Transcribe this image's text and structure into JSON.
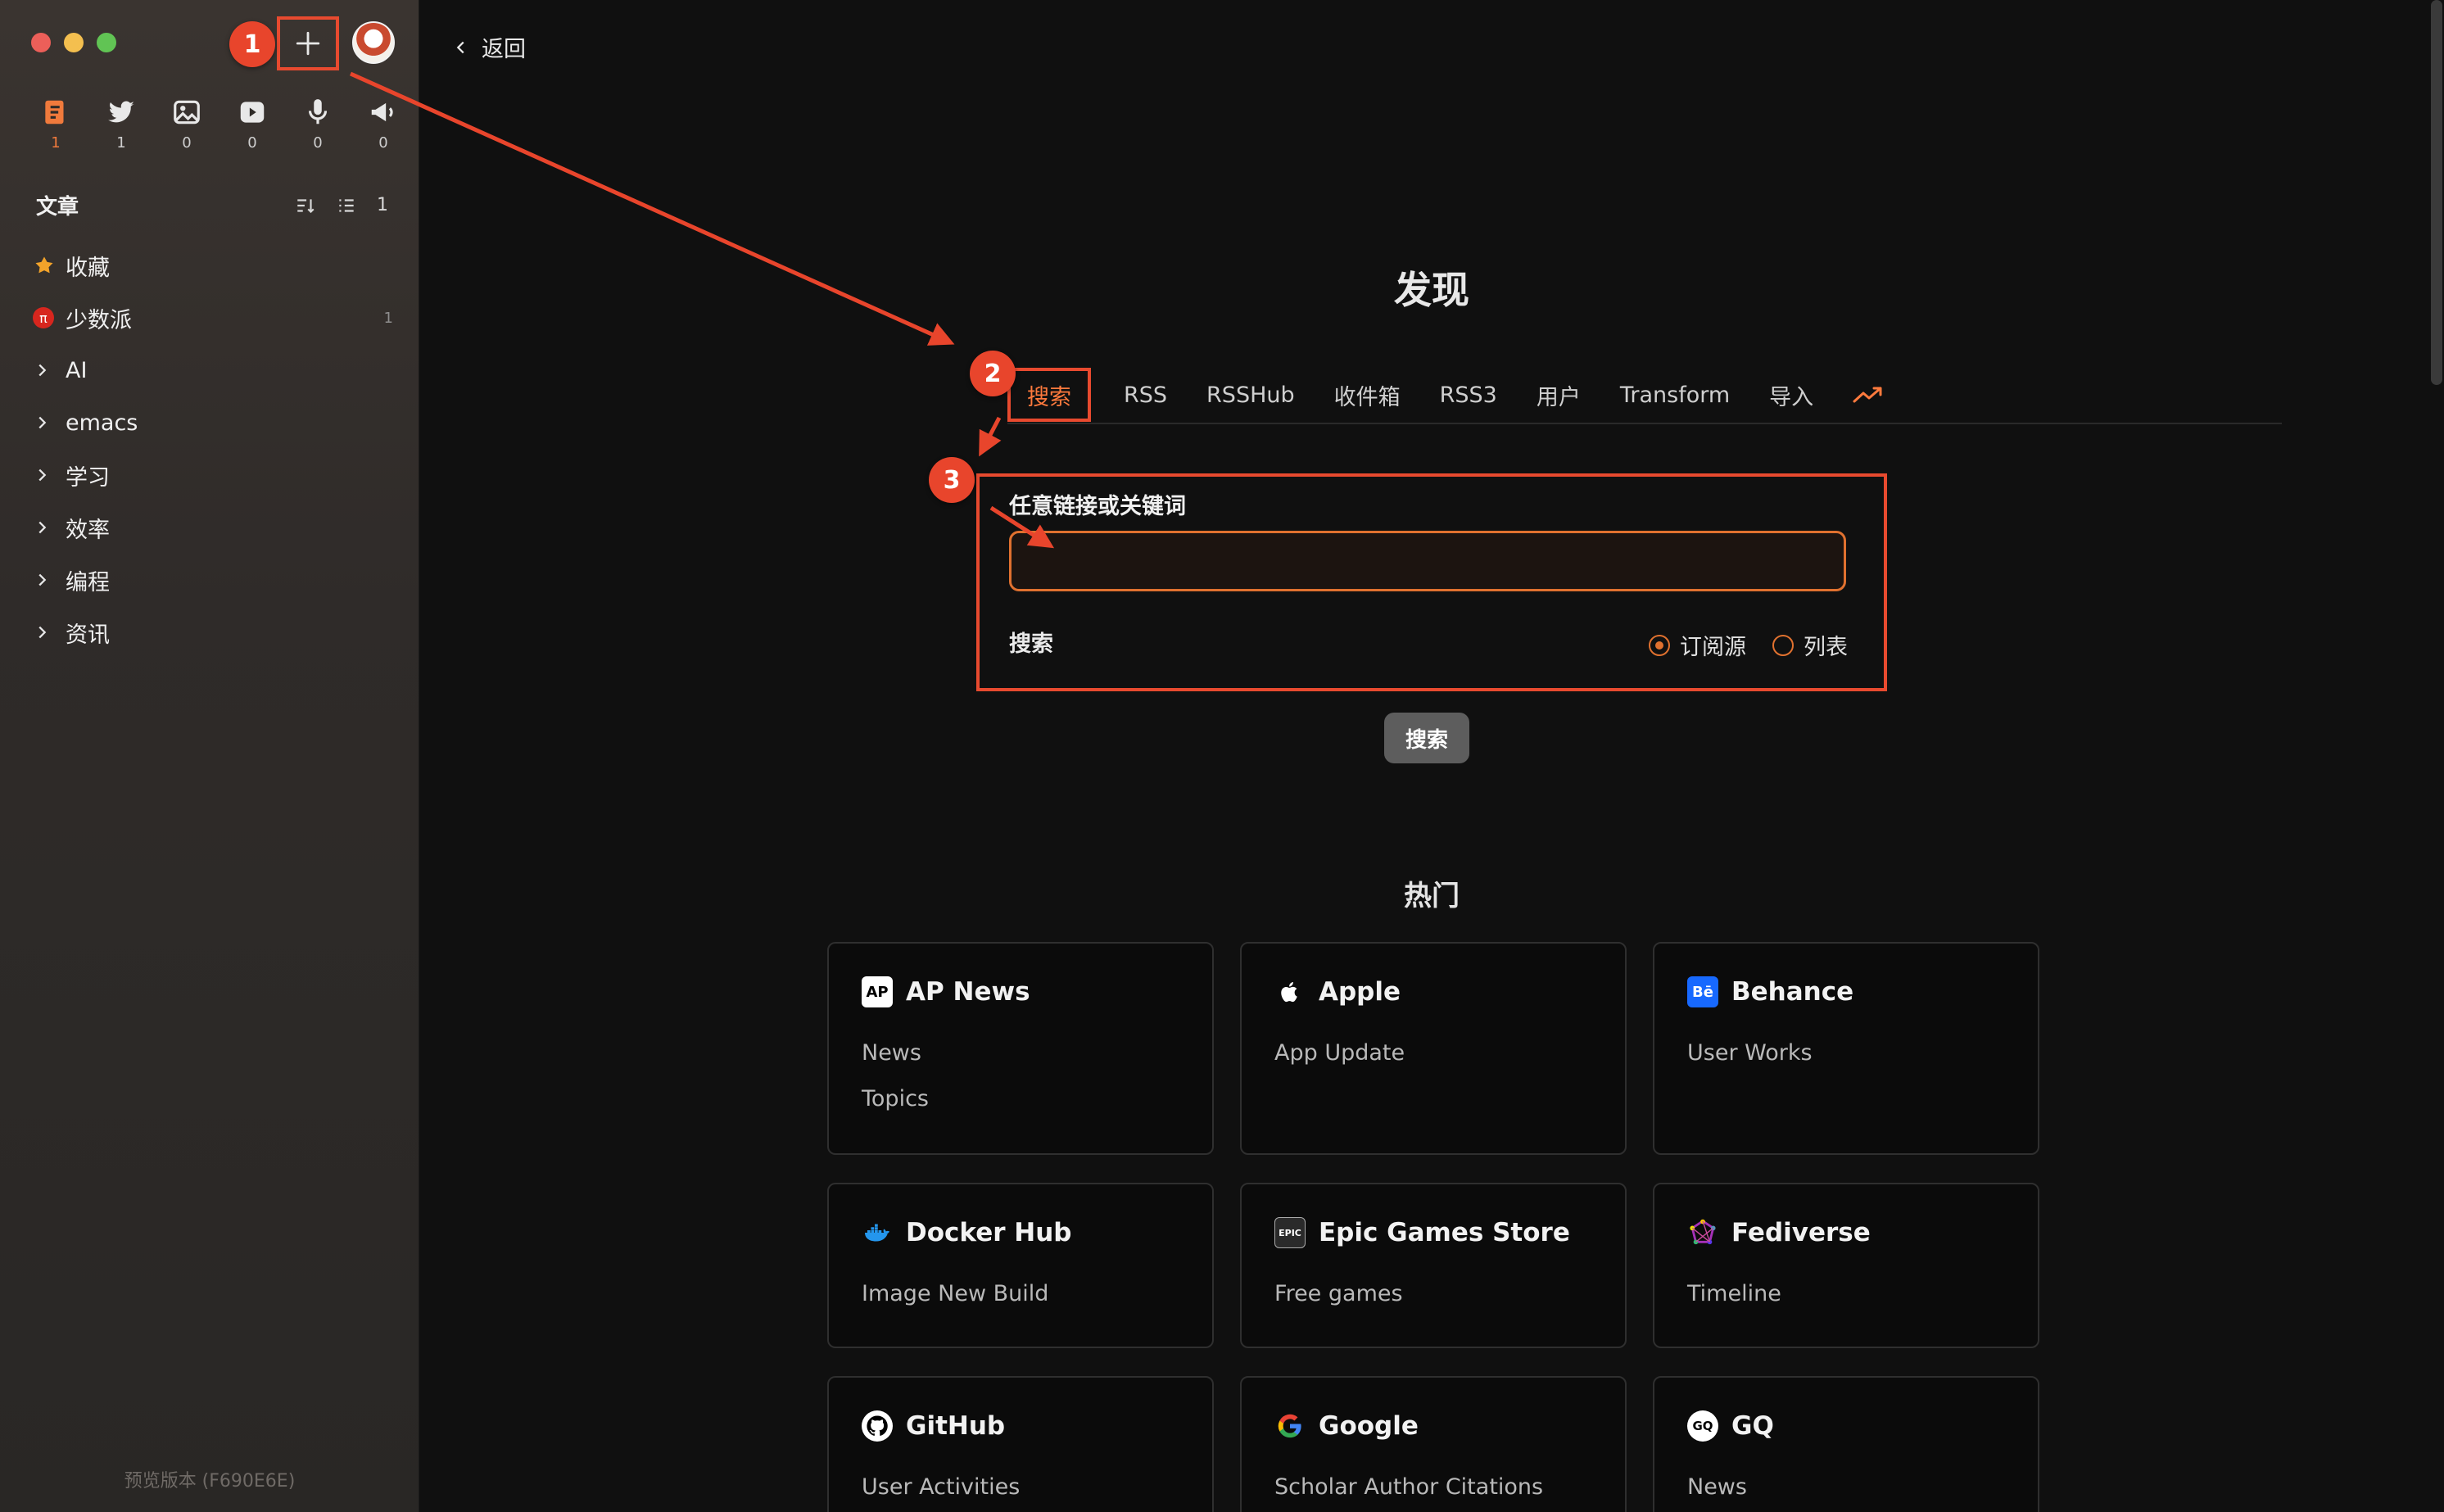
{
  "window": {
    "controls": [
      "close",
      "minimize",
      "zoom"
    ]
  },
  "sidebar": {
    "add_icon": "plus-icon",
    "views": [
      {
        "icon": "article-icon",
        "count": "1",
        "active": true
      },
      {
        "icon": "twitter-icon",
        "count": "1"
      },
      {
        "icon": "picture-icon",
        "count": "0"
      },
      {
        "icon": "video-icon",
        "count": "0"
      },
      {
        "icon": "microphone-icon",
        "count": "0"
      },
      {
        "icon": "megaphone-icon",
        "count": "0"
      }
    ],
    "section_title": "文章",
    "section_count": "1",
    "items": [
      {
        "label": "收藏",
        "icon": "star-icon"
      },
      {
        "label": "少数派",
        "icon": "pi-icon",
        "count": "1"
      },
      {
        "label": "AI",
        "icon": "chevron-right-icon"
      },
      {
        "label": "emacs",
        "icon": "chevron-right-icon"
      },
      {
        "label": "学习",
        "icon": "chevron-right-icon"
      },
      {
        "label": "效率",
        "icon": "chevron-right-icon"
      },
      {
        "label": "编程",
        "icon": "chevron-right-icon"
      },
      {
        "label": "资讯",
        "icon": "chevron-right-icon"
      }
    ],
    "version": "预览版本 (F690E6E)"
  },
  "main": {
    "back_label": "返回",
    "title": "发现",
    "tabs": [
      "搜索",
      "RSS",
      "RSSHub",
      "收件箱",
      "RSS3",
      "用户",
      "Transform",
      "导入"
    ],
    "trend_icon": "trending-up-icon",
    "search": {
      "label": "任意链接或关键词",
      "value": "",
      "sub_label": "搜索",
      "radio_feed": "订阅源",
      "radio_list": "列表",
      "selected": "订阅源",
      "button": "搜索"
    },
    "hot_title": "热门",
    "cards": [
      {
        "name": "AP News",
        "icon": "ap-news-icon",
        "icon_text": "AP",
        "icon_bg": "#ffffff",
        "icon_fg": "#000000",
        "items": [
          "News",
          "Topics"
        ]
      },
      {
        "name": "Apple",
        "icon": "apple-icon",
        "icon_text": "",
        "icon_bg": "transparent",
        "icon_fg": "#ffffff",
        "items": [
          "App Update"
        ]
      },
      {
        "name": "Behance",
        "icon": "behance-icon",
        "icon_text": "Bē",
        "icon_bg": "#1769ff",
        "icon_fg": "#ffffff",
        "items": [
          "User Works"
        ]
      },
      {
        "name": "Docker Hub",
        "icon": "docker-icon",
        "icon_text": "",
        "icon_bg": "transparent",
        "icon_fg": "#2496ed",
        "items": [
          "Image New Build"
        ]
      },
      {
        "name": "Epic Games Store",
        "icon": "epic-games-icon",
        "icon_text": "EPIC",
        "icon_bg": "#2a2a2a",
        "icon_fg": "#ffffff",
        "items": [
          "Free games"
        ]
      },
      {
        "name": "Fediverse",
        "icon": "fediverse-icon",
        "icon_text": "",
        "icon_bg": "transparent",
        "icon_fg": "#a730b8",
        "items": [
          "Timeline"
        ]
      },
      {
        "name": "GitHub",
        "icon": "github-icon",
        "icon_text": "",
        "icon_bg": "#ffffff",
        "icon_fg": "#000000",
        "items": [
          "User Activities"
        ]
      },
      {
        "name": "Google",
        "icon": "google-icon",
        "icon_text": "G",
        "icon_bg": "transparent",
        "icon_fg": "#4285f4",
        "items": [
          "Scholar Author Citations"
        ]
      },
      {
        "name": "GQ",
        "icon": "gq-icon",
        "icon_text": "GQ",
        "icon_bg": "#ffffff",
        "icon_fg": "#000000",
        "items": [
          "News"
        ]
      }
    ]
  },
  "annotations": {
    "badges": [
      "1",
      "2",
      "3"
    ],
    "color": "#e8452c"
  }
}
